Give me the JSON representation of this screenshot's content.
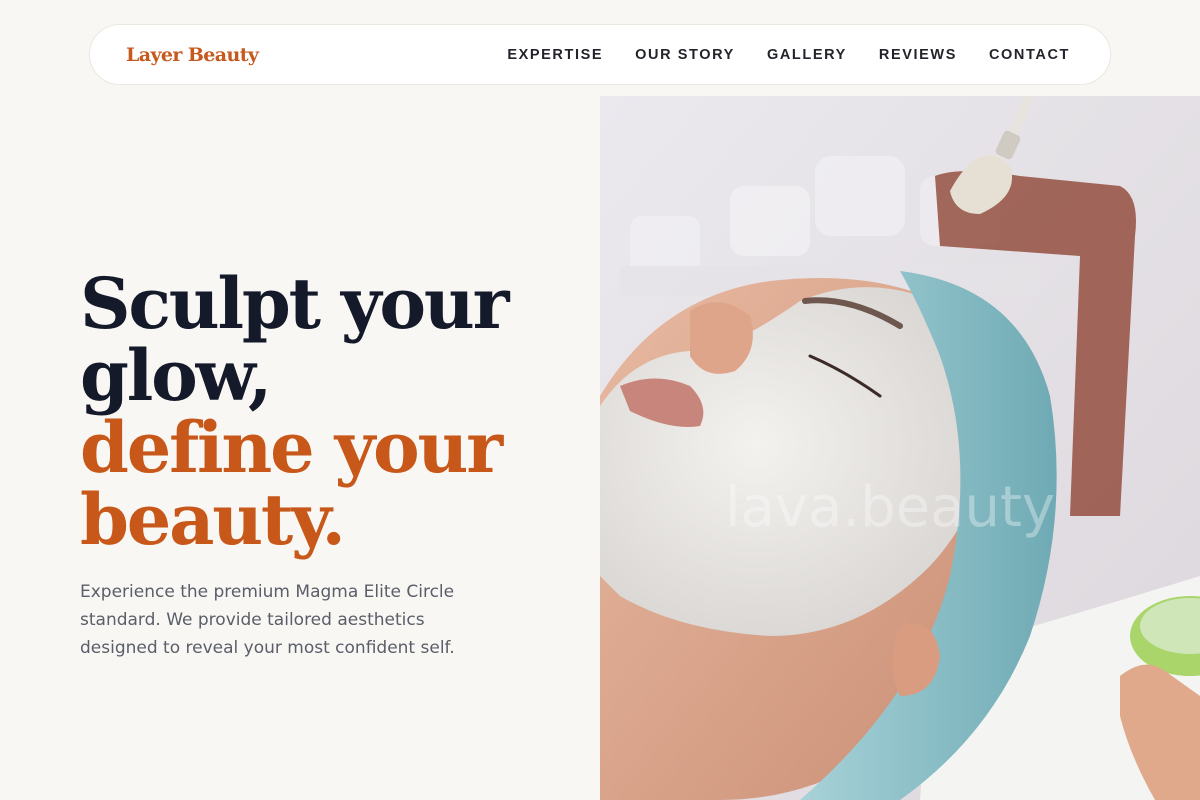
{
  "brand": {
    "name": "Layer Beauty"
  },
  "nav": {
    "items": [
      {
        "label": "EXPERTISE"
      },
      {
        "label": "OUR STORY"
      },
      {
        "label": "GALLERY"
      },
      {
        "label": "REVIEWS"
      },
      {
        "label": "CONTACT"
      }
    ]
  },
  "hero": {
    "headline_line1": "Sculpt your",
    "headline_line2": "glow,",
    "headline_accent1": "define your",
    "headline_accent2": "beauty.",
    "description": "Experience the premium Magma Elite Circle standard. We provide tailored aesthetics designed to reveal your most confident self.",
    "image_watermark": "lava.beauty"
  },
  "colors": {
    "background": "#f9f7f4",
    "accent": "#c8571a",
    "heading": "#141a2a",
    "body_text": "#5a5e68",
    "towel": "#8fc4cc"
  }
}
